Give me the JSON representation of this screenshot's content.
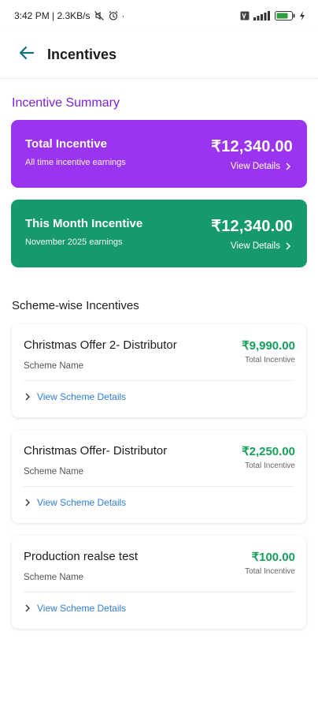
{
  "status_bar": {
    "time_speed": "3:42 PM | 2.3KB/s",
    "dot": "·",
    "icons": [
      "mute-icon",
      "alarm-icon",
      "volte-icon",
      "signal-icon",
      "battery-icon",
      "charging-icon"
    ]
  },
  "header": {
    "title": "Incentives",
    "back_icon": "arrow-left-icon"
  },
  "summary": {
    "heading": "Incentive Summary",
    "heading_color": "#7b1fe0",
    "cards": [
      {
        "title": "Total Incentive",
        "subtitle": "All time incentive earnings",
        "amount": "₹12,340.00",
        "link": "View Details",
        "color": "#9b34ee"
      },
      {
        "title": "This Month Incentive",
        "subtitle": "November 2025 earnings",
        "amount": "₹12,340.00",
        "link": "View Details",
        "color": "#169a6c"
      }
    ]
  },
  "schemes": {
    "heading": "Scheme-wise Incentives",
    "amount_color": "#17a05b",
    "link_color": "#2f7ed8",
    "items": [
      {
        "name": "Christmas Offer 2- Distributor",
        "label": "Scheme Name",
        "amount": "₹9,990.00",
        "amount_label": "Total Incentive",
        "link": "View Scheme Details"
      },
      {
        "name": "Christmas Offer- Distributor",
        "label": "Scheme Name",
        "amount": "₹2,250.00",
        "amount_label": "Total Incentive",
        "link": "View Scheme Details"
      },
      {
        "name": "Production realse test",
        "label": "Scheme Name",
        "amount": "₹100.00",
        "amount_label": "Total Incentive",
        "link": "View Scheme Details"
      }
    ]
  }
}
